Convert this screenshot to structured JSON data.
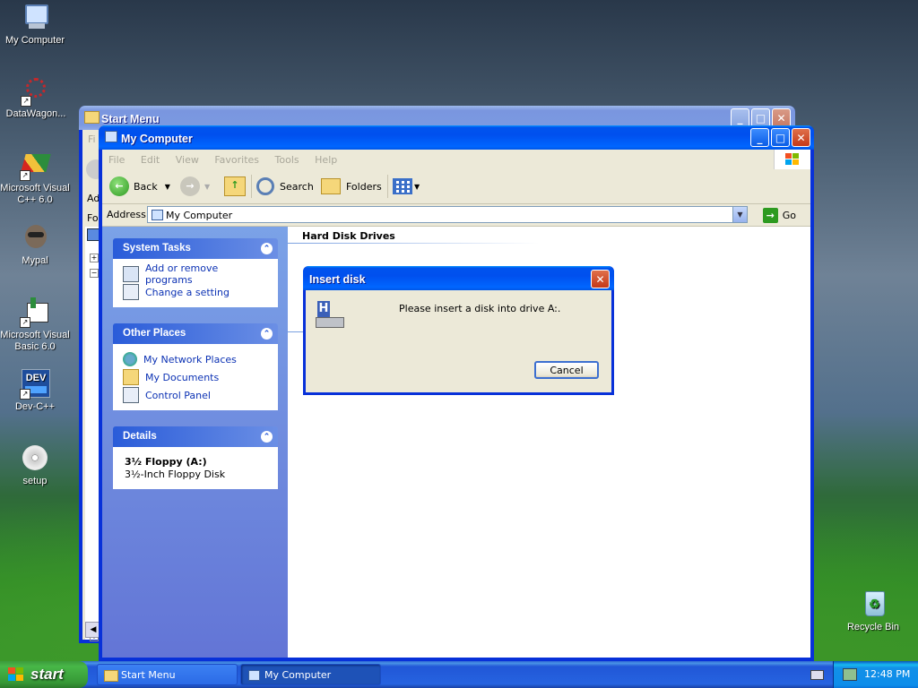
{
  "desktop": {
    "icons": [
      {
        "label": "My Computer"
      },
      {
        "label": "DataWagon..."
      },
      {
        "label": "Microsoft Visual C++ 6.0"
      },
      {
        "label": "Mypal"
      },
      {
        "label": "Microsoft Visual Basic 6.0"
      },
      {
        "label": "Dev-C++"
      },
      {
        "label": "setup"
      },
      {
        "label": "Recycle Bin"
      }
    ]
  },
  "back_window": {
    "title": "Start Menu",
    "fragments": {
      "menu": "Fi",
      "addr": "Ad",
      "folders": "Fo"
    }
  },
  "main_window": {
    "title": "My Computer",
    "menu": [
      "File",
      "Edit",
      "View",
      "Favorites",
      "Tools",
      "Help"
    ],
    "toolbar": {
      "back": "Back",
      "search": "Search",
      "folders": "Folders"
    },
    "address": {
      "label": "Address",
      "value": "My Computer",
      "go": "Go"
    },
    "section_heading": "Hard Disk Drives",
    "panels": {
      "system_tasks": {
        "title": "System Tasks",
        "items": [
          "Add or remove programs",
          "Change a setting"
        ]
      },
      "other_places": {
        "title": "Other Places",
        "items": [
          "My Network Places",
          "My Documents",
          "Control Panel"
        ]
      },
      "details": {
        "title": "Details",
        "name": "3½ Floppy (A:)",
        "desc": "3½-Inch Floppy Disk"
      }
    }
  },
  "dialog": {
    "title": "Insert disk",
    "message": "Please insert a disk into drive A:.",
    "cancel": "Cancel"
  },
  "taskbar": {
    "start": "start",
    "tasks": [
      "Start Menu",
      "My Computer"
    ],
    "clock": "12:48 PM"
  },
  "colors": {
    "accent": "#0054e3",
    "link": "#0c32b4",
    "start_green": "#3c9b3c"
  }
}
